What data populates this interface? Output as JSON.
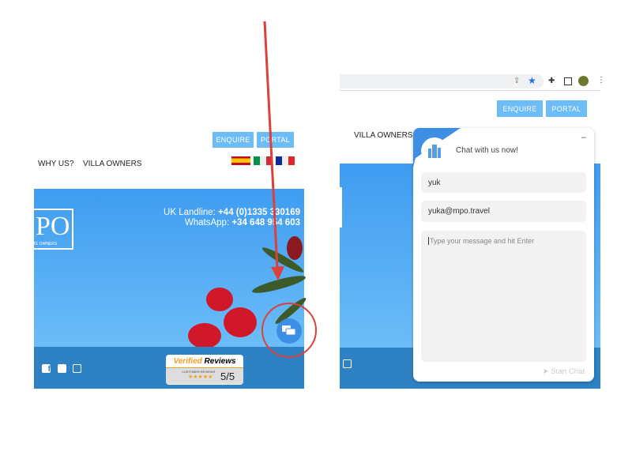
{
  "left": {
    "buttons": {
      "enquire": "ENQUIRE",
      "portal": "PORTAL"
    },
    "nav": [
      "WHY US?",
      "VILLA OWNERS"
    ],
    "logo": {
      "letters": "PO",
      "tagline": "ATE OWNERS"
    },
    "contact": {
      "landline_label": "UK Landline: ",
      "landline": "+44 (0)1335 330169",
      "whatsapp_label": "WhatsApp: ",
      "whatsapp": "+34 648 954 603"
    },
    "reviews": {
      "verified": "Verified",
      "reviews": "Reviews",
      "customer": "CUSTOMER REVIEWS",
      "stars": "★★★★★",
      "score": "5/5"
    }
  },
  "right": {
    "buttons": {
      "enquire": "ENQUIRE",
      "portal": "PORTAL"
    },
    "nav": "VILLA OWNERS",
    "chat": {
      "title": "Chat with us now!",
      "minimize": "–",
      "name_value": "yuk",
      "email_value": "yuka@mpo.travel",
      "message_placeholder": "Type your message and hit Enter",
      "start": "Start Chat"
    }
  },
  "colors": {
    "accent": "#3d8fe6",
    "button": "#6bbcf7",
    "annotation": "#d9413a"
  }
}
